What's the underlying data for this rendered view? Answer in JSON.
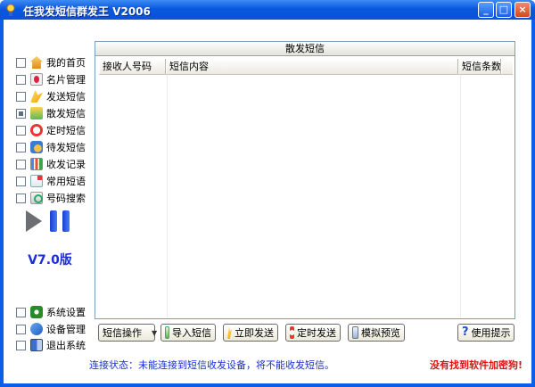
{
  "window": {
    "title": "任我发短信群发王 V2006",
    "minimize_glyph": "_",
    "maximize_glyph": "□",
    "close_glyph": "×"
  },
  "sidebar": {
    "items": [
      {
        "label": "我的首页",
        "icon": "home-icon",
        "checked": false
      },
      {
        "label": "名片管理",
        "icon": "card-icon",
        "checked": false
      },
      {
        "label": "发送短信",
        "icon": "send-icon",
        "checked": false
      },
      {
        "label": "散发短信",
        "icon": "group-send-icon",
        "checked": true
      },
      {
        "label": "定时短信",
        "icon": "alarm-clock-icon",
        "checked": false
      },
      {
        "label": "待发短信",
        "icon": "pending-icon",
        "checked": false
      },
      {
        "label": "收发记录",
        "icon": "chart-icon",
        "checked": false
      },
      {
        "label": "常用短语",
        "icon": "notes-icon",
        "checked": false
      },
      {
        "label": "号码搜索",
        "icon": "search-icon",
        "checked": false
      }
    ],
    "version": "V7.0版",
    "bottom_items": [
      {
        "label": "系统设置",
        "icon": "gear-icon"
      },
      {
        "label": "设备管理",
        "icon": "device-icon"
      },
      {
        "label": "退出系统",
        "icon": "exit-icon"
      }
    ]
  },
  "panel": {
    "title": "散发短信",
    "columns": [
      "接收人号码",
      "短信内容",
      "短信条数",
      ""
    ]
  },
  "toolbar": {
    "sms_ops": "短信操作",
    "import": "导入短信",
    "send_now": "立即发送",
    "timed_send": "定时发送",
    "preview": "模拟预览",
    "help": "使用提示",
    "help_glyph": "?"
  },
  "status": {
    "message": "连接状态：未能连接到短信收发设备，将不能收发短信。",
    "warning": "没有找到软件加密狗!"
  },
  "colors": {
    "titlebar": "#0a58e0",
    "status_text": "#1a2fd8",
    "warning_text": "#e01010"
  }
}
